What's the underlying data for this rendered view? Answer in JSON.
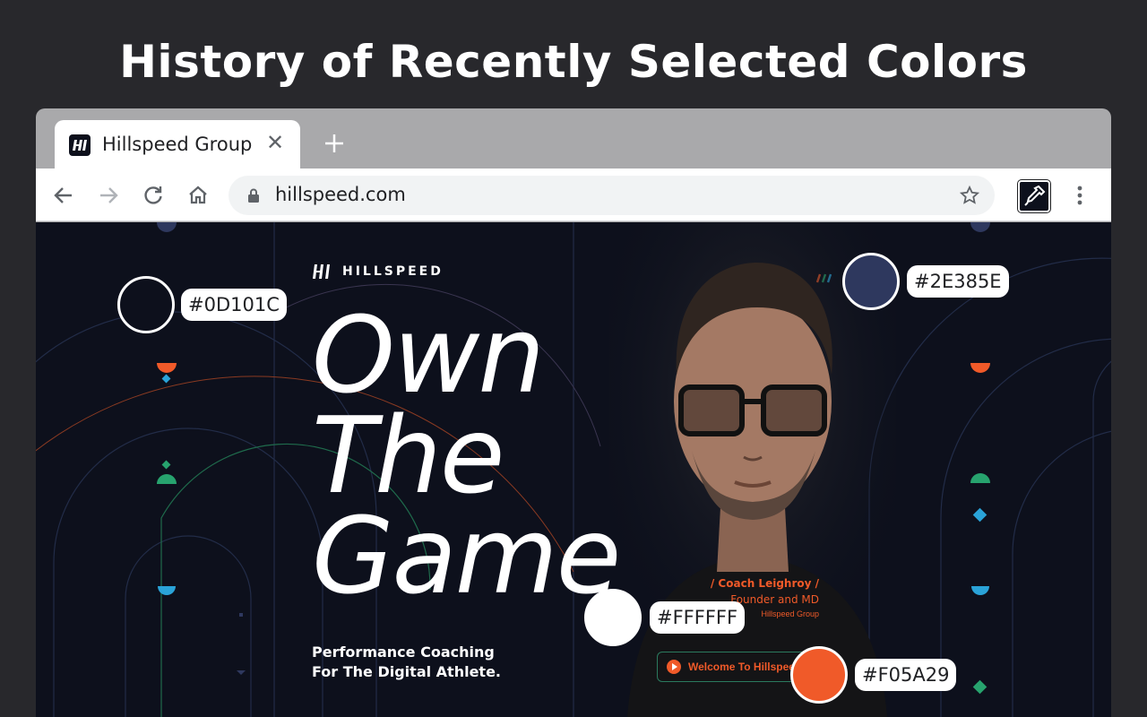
{
  "headline": "History of Recently Selected Colors",
  "browser": {
    "tab": {
      "title": "Hillspeed Group",
      "favicon": "hillspeed-logo-icon",
      "close": "✕"
    },
    "new_tab": "plus-icon",
    "address": {
      "url": "hillspeed.com"
    }
  },
  "site": {
    "logo_text": "HILLSPEED",
    "hero_lines": [
      "Own",
      "The",
      "Game"
    ],
    "subtitle_lines": [
      "Performance Coaching",
      "For The Digital Athlete."
    ],
    "coach": {
      "name": "/ Coach Leighroy /",
      "role": "Founder and MD",
      "org": "Hillspeed Group"
    },
    "cta_label": "Welcome To Hillspeed"
  },
  "swatches": [
    {
      "hex": "#0D101C",
      "color": "#0d101c"
    },
    {
      "hex": "#2E385E",
      "color": "#2e385e"
    },
    {
      "hex": "#FFFFFF",
      "color": "#ffffff"
    },
    {
      "hex": "#F05A29",
      "color": "#f05a29"
    }
  ],
  "colors": {
    "orange": "#f05a29",
    "green": "#27a36e",
    "blue": "#2aa3d8",
    "navy": "#2e385e"
  }
}
